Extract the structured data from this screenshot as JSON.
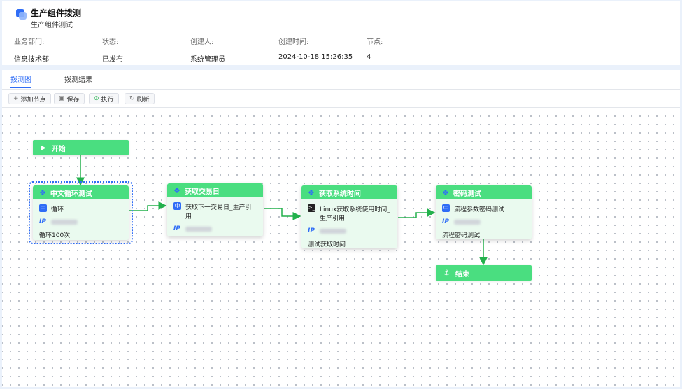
{
  "header": {
    "title": "生产组件拨测",
    "subtitle": "生产组件测试",
    "meta": [
      {
        "label": "业务部门:",
        "value": "信息技术部"
      },
      {
        "label": "状态:",
        "value": "已发布"
      },
      {
        "label": "创建人:",
        "value": "系统管理员"
      },
      {
        "label": "创建时间:",
        "value": "2024-10-18 15:26:35"
      },
      {
        "label": "节点:",
        "value": "4"
      }
    ]
  },
  "tabs": [
    {
      "label": "拨测图",
      "active": true
    },
    {
      "label": "拨测结果",
      "active": false
    }
  ],
  "toolbar": {
    "add_node": "添加节点",
    "save": "保存",
    "execute": "执行",
    "refresh": "刷新"
  },
  "flow": {
    "start": "开始",
    "end": "结束",
    "nodes": [
      {
        "title": "中文循环测试",
        "icon": "chinese-badge-icon",
        "task": "循环",
        "ip_label": "IP",
        "desc": "循环100次"
      },
      {
        "title": "获取交易日",
        "icon": "chinese-badge-icon",
        "task": "获取下一交易日_生产引用",
        "ip_label": "IP",
        "desc": ""
      },
      {
        "title": "获取系统时间",
        "icon": "terminal-icon",
        "task": "Linux获取系统使用时间_生产引用",
        "ip_label": "IP",
        "desc": "测试获取时间"
      },
      {
        "title": "密码测试",
        "icon": "chinese-badge-icon",
        "task": "流程参数密码测试",
        "ip_label": "IP",
        "desc": "流程密码测试"
      }
    ],
    "node_badge": "中",
    "terminal_glyph": ">_"
  },
  "colors": {
    "accent": "#2f6df6",
    "node_header": "#4ade80",
    "node_body": "#eafaef",
    "edge": "#22b14c"
  }
}
